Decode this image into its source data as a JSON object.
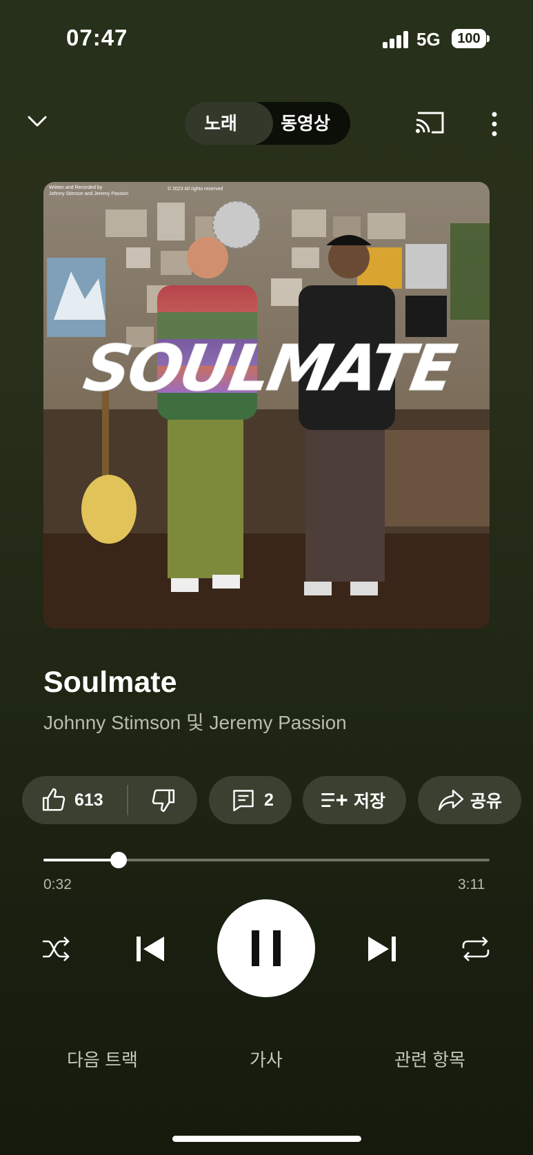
{
  "status_bar": {
    "time": "07:47",
    "network": "5G",
    "battery": "100"
  },
  "top_bar": {
    "tab_song": "노래",
    "tab_video": "동영상"
  },
  "track": {
    "title": "Soulmate",
    "artist": "Johnny Stimson 및 Jeremy Passion",
    "artwork": {
      "headline": "SOULMATE",
      "credit": "Written and Recorded by\nJohnny Stimson and Jeremy Passion",
      "copyright": "© 2023 All rights reserved"
    }
  },
  "actions": {
    "likes": "613",
    "comments": "2",
    "save": "저장",
    "share": "공유"
  },
  "progress": {
    "current": "0:32",
    "total": "3:11",
    "fraction": 0.168
  },
  "bottom_tabs": {
    "up_next": "다음 트랙",
    "lyrics": "가사",
    "related": "관련 항목"
  },
  "colors": {
    "background": "#27301a",
    "chip": "#3a4130",
    "accent": "#ffffff"
  },
  "icons": [
    "chevron-down-icon",
    "cast-icon",
    "more-vert-icon",
    "thumb-up-icon",
    "thumb-down-icon",
    "comment-icon",
    "playlist-add-icon",
    "share-icon",
    "shuffle-icon",
    "previous-icon",
    "pause-icon",
    "next-icon",
    "repeat-icon"
  ]
}
